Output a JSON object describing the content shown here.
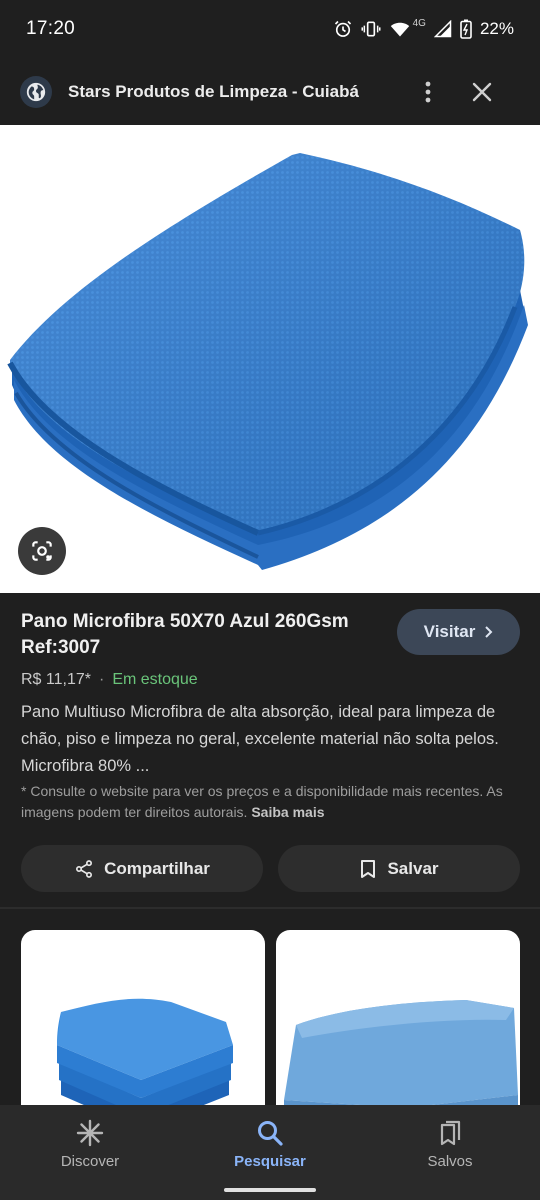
{
  "status_bar": {
    "time": "17:20",
    "network": "4G",
    "battery": "22%",
    "icons": [
      "alarm-icon",
      "vibrate-icon",
      "wifi-icon",
      "signal-icon",
      "battery-icon"
    ]
  },
  "title_bar": {
    "site_icon": "globe-icon",
    "title": "Stars Produtos de Limpeza - Cuiabá",
    "menu_icon": "more-vert-icon",
    "close_icon": "close-icon"
  },
  "hero": {
    "image": "blue-microfiber-towel-folded",
    "lens_icon": "google-lens-icon"
  },
  "product": {
    "title": "Pano Microfibra 50X70 Azul 260Gsm Ref:3007",
    "visit_label": "Visitar",
    "price": "R$ 11,17*",
    "separator": "·",
    "availability": "Em estoque",
    "description": "Pano Multiuso Microfibra de alta absorção, ideal para limpeza de chão, piso e limpeza no geral, excelente material não solta pelos. Microfibra 80% ...",
    "notice": "* Consulte o website para ver os preços e a disponibilidade mais recentes. As imagens podem ter direitos autorais.",
    "notice_link": "Saiba mais",
    "share_label": "Compartilhar",
    "save_label": "Salvar"
  },
  "related": {
    "cards": [
      {
        "image": "stacked-blue-microfiber-cloths"
      },
      {
        "image": "light-blue-microfiber-cloth"
      }
    ]
  },
  "bottom_nav": {
    "items": [
      {
        "label": "Discover",
        "icon": "asterisk-icon",
        "active": false
      },
      {
        "label": "Pesquisar",
        "icon": "search-icon",
        "active": true
      },
      {
        "label": "Salvos",
        "icon": "bookmarks-icon",
        "active": false
      }
    ]
  },
  "colors": {
    "background": "#1f1f1f",
    "accent": "#8ab4f8",
    "in_stock": "#6ac47a",
    "visit_button": "#3c4757"
  }
}
